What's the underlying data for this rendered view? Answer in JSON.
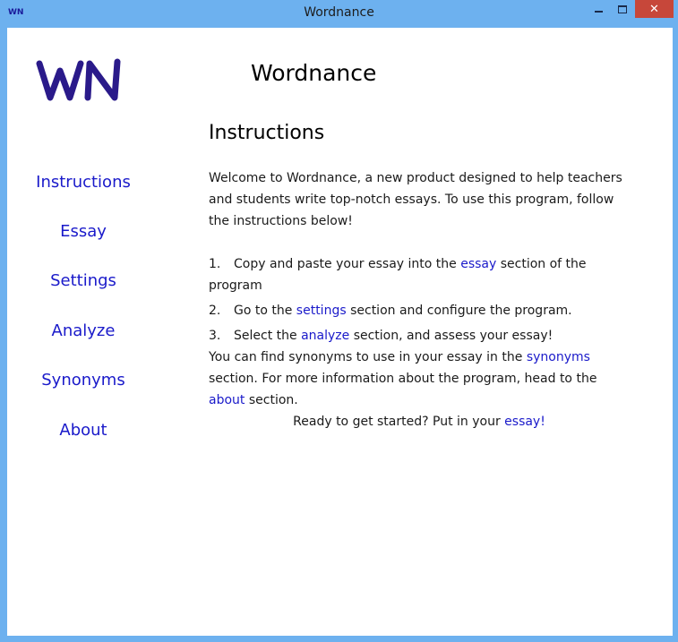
{
  "window": {
    "icon_text": "WN",
    "title": "Wordnance",
    "controls": {
      "minimize": "",
      "maximize": "",
      "close": "✕"
    }
  },
  "logo": {
    "text": "WN",
    "color": "#2a1a8a"
  },
  "header": {
    "title": "Wordnance"
  },
  "sidebar": {
    "items": [
      {
        "label": "Instructions"
      },
      {
        "label": "Essay"
      },
      {
        "label": "Settings"
      },
      {
        "label": "Analyze"
      },
      {
        "label": "Synonyms"
      },
      {
        "label": "About"
      }
    ]
  },
  "main": {
    "section_title": "Instructions",
    "intro": "Welcome to Wordnance, a new product designed to help teachers and students write top-notch essays. To use this program, follow the instructions below!",
    "steps": [
      {
        "num": "1.",
        "before": "Copy and paste your essay into the ",
        "link": "essay",
        "after": " section of the program"
      },
      {
        "num": "2.",
        "before": "Go to the ",
        "link": "settings",
        "after": " section and configure the program."
      },
      {
        "num": "3.",
        "before": "Select the ",
        "link": "analyze",
        "after": " section, and assess your essay!"
      }
    ],
    "synonyms_text": {
      "before": "You can find synonyms to use in your essay in the ",
      "link1": "synonyms",
      "middle": " section. For more information about the program, head to the ",
      "link2": "about",
      "after": " section."
    },
    "ready": {
      "before": "Ready to get started? Put in your ",
      "link": "essay!"
    }
  },
  "colors": {
    "accent_link": "#1a1aca",
    "titlebar": "#6db1ef",
    "close_button": "#c7473a"
  }
}
